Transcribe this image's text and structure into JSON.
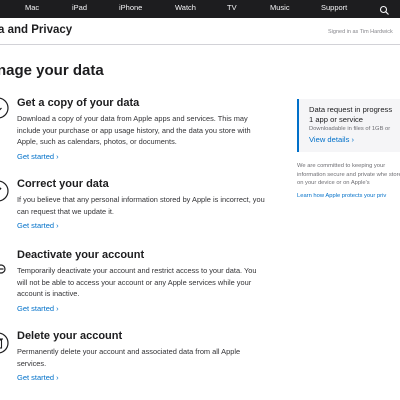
{
  "globalnav": {
    "items": [
      "Mac",
      "iPad",
      "iPhone",
      "Watch",
      "TV",
      "Music",
      "Support"
    ],
    "search_icon": "search-icon"
  },
  "subheader": {
    "title": "a and Privacy",
    "signed_in": "Signed in as Tim Hardwick"
  },
  "page_title": "nage your data",
  "options": [
    {
      "title": "Get a copy of your data",
      "description": "Download a copy of your data from Apple apps and services. This may include your purchase or app usage history, and the data you store with Apple, such as calendars, photos, or documents.",
      "link": "Get started ›",
      "icon": "download-icon"
    },
    {
      "title": "Correct your data",
      "description": "If you believe that any personal information stored by Apple is incorrect, you can request that we update it.",
      "link": "Get started ›",
      "icon": "pencil-icon"
    },
    {
      "title": "Deactivate your account",
      "description": "Temporarily deactivate your account and restrict access to your data. You will not be able to access your account or any Apple services while your account is inactive.",
      "link": "Get started ›",
      "icon": "deactivate-icon"
    },
    {
      "title": "Delete your account",
      "description": "Permanently delete your account and associated data from all Apple services.",
      "link": "Get started ›",
      "icon": "trash-icon"
    }
  ],
  "sidebar": {
    "card_title": "Data request in progress",
    "card_count": "1 app or service",
    "card_sub": "Downloadable in files of 1GB or",
    "card_link": "View details ›",
    "note": "We are committed to keeping your information secure and private whe stored on your device or on Apple's",
    "learn_link": "Learn how Apple protects your priv"
  },
  "colors": {
    "nav_bg": "#1d1d1f",
    "link": "#0070c9",
    "card_bg": "#f5f5f7",
    "text": "#1d1d1f"
  }
}
